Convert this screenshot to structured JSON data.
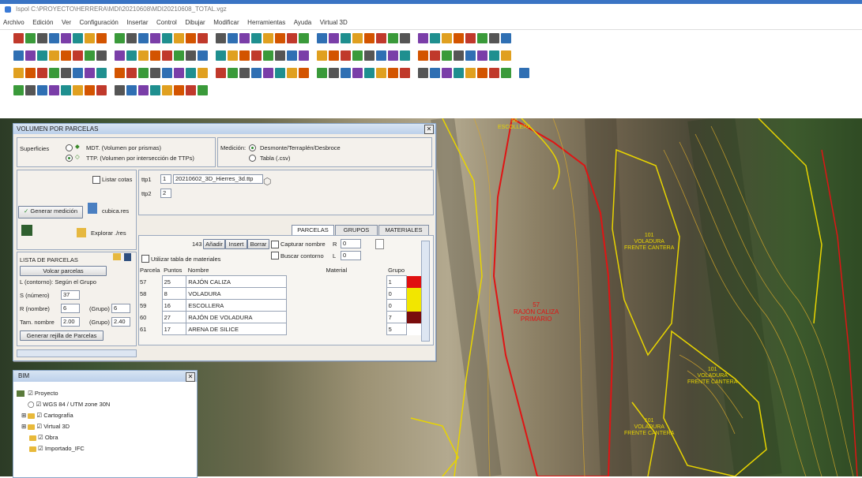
{
  "window": {
    "title": "Ispol C:\\PROYECTO\\HERRERA\\MDI\\20210608\\MDI20210608_TOTAL.vgz"
  },
  "menu": [
    "Archivo",
    "Edición",
    "Ver",
    "Configuración",
    "Insertar",
    "Control",
    "Dibujar",
    "Modificar",
    "Herramientas",
    "Ayuda",
    "Virtual 3D"
  ],
  "toolbar_colors": [
    "#c0392b",
    "#2f6fb3",
    "#e0a020",
    "#3a9a3a",
    "#7a3ea8",
    "#d35400",
    "#555555",
    "#1f8f8f"
  ],
  "panel": {
    "title": "VOLUMEN POR PARCELAS",
    "superficies_label": "Superficies",
    "option_mdt": "MDT. (Volumen por prismas)",
    "option_ttp": "TTP. (Volumen por intersección de TTPs)",
    "medicion_label": "Medición:",
    "option_desmonte": "Desmonte/Terraplén/Desbroce",
    "option_tabla": "Tabla (.csv)",
    "listar_cotas": "Listar cotas",
    "generar_medicion": "Generar medición",
    "cubicar": "cubica.res",
    "explorar": "Explorar ./res",
    "ttp1_label": "ttp1",
    "ttp1_num": "1",
    "ttp1_value": "20210602_3D_Hierres_3d.ttp",
    "ttp2_label": "ttp2",
    "ttp2_num": "2",
    "tabs": [
      "PARCELAS",
      "GRUPOS",
      "MATERIALES"
    ],
    "count": "143",
    "btn_anadir": "Añadir",
    "btn_insertar": "Insert",
    "btn_borrar": "Borrar",
    "capturar_nombre": "Capturar nombre",
    "buscar_contorno": "Buscar contorno",
    "r_label": "R",
    "r_value": "0",
    "l_label": "L",
    "l_value": "0",
    "utilizar_tabla": "Utilizar tabla de materiales",
    "columns": [
      "Parcela",
      "Puntos",
      "Nombre",
      "Material",
      "Grupo"
    ],
    "rows": [
      {
        "parcela": "57",
        "puntos": "25",
        "nombre": "RAJÓN CALIZA",
        "grupo": "1",
        "color": "#e01010"
      },
      {
        "parcela": "58",
        "puntos": "8",
        "nombre": "VOLADURA",
        "grupo": "0",
        "color": "#f2e600"
      },
      {
        "parcela": "59",
        "puntos": "16",
        "nombre": "ESCOLLERA",
        "grupo": "0",
        "color": "#f2e600"
      },
      {
        "parcela": "60",
        "puntos": "27",
        "nombre": "RAJÓN DE VOLADURA",
        "grupo": "7",
        "color": "#7a0d0d"
      },
      {
        "parcela": "61",
        "puntos": "17",
        "nombre": "ARENA DE SILICE",
        "grupo": "5",
        "color": "#ffffff"
      }
    ],
    "lista_parcelas": "LISTA DE PARCELAS",
    "volcar_parcelas": "Volcar parcelas",
    "l_contorno": "L (contorno): Según el Grupo",
    "s_label": "S (número)",
    "s_value": "37",
    "r_nombre_label": "R (nombre)",
    "r_nombre_value": "6",
    "grupo1_label": "(Grupo)",
    "grupo1_value": "6",
    "tam_label": "Tam. nombre",
    "tam_value": "2.00",
    "grupo2_label": "(Grupo)",
    "grupo2_value": "2.40",
    "generar_rejilla": "Generar rejilla de Parcelas"
  },
  "bim": {
    "title": "BIM",
    "items": [
      "Proyecto",
      "WGS 84 / UTM zone 30N",
      "Cartografía",
      "Virtual 3D",
      "Obra",
      "Importado_IFC"
    ]
  },
  "map_labels": {
    "center": "57\nRAJÓN CALIZA\nPRIMARIO",
    "top": "56\nESCOLLERA",
    "right1": "101\nVOLADURA\nFRENTE CANTERA",
    "right2": "101\nVOLADURA\nFRENTE CANTERA",
    "bottom": "101\nVOLADURA\nFRENTE CANTERA"
  }
}
